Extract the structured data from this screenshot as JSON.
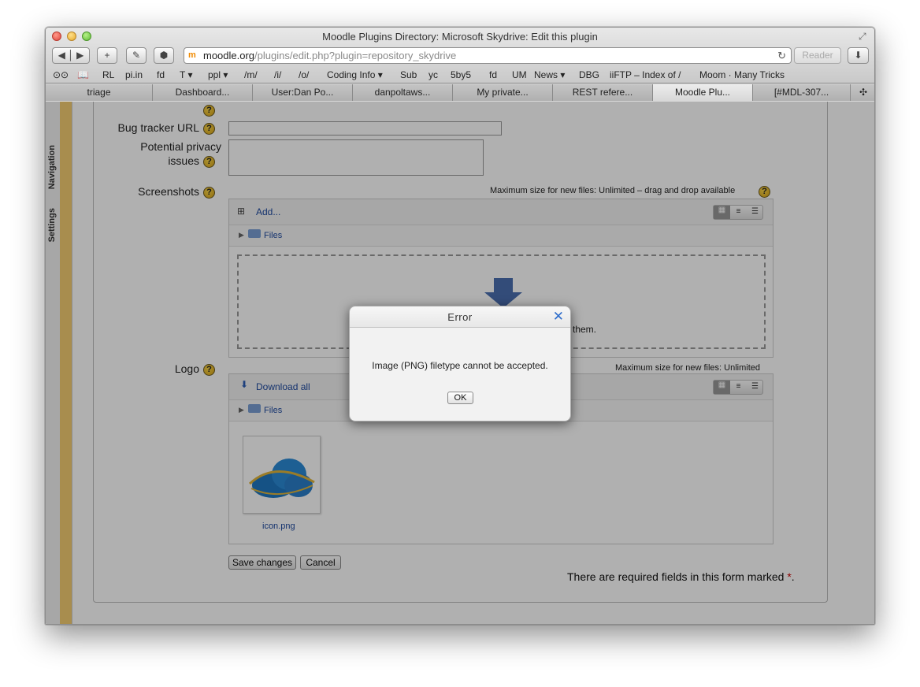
{
  "window": {
    "title": "Moodle Plugins Directory: Microsoft Skydrive: Edit this plugin"
  },
  "toolbar": {
    "url_host": "moodle.org",
    "url_path": "/plugins/edit.php?plugin=repository_skydrive",
    "reader_label": "Reader"
  },
  "bookmarks": [
    "RL",
    "pi.in",
    "fd",
    "T ▾",
    "ppl ▾",
    "/m/",
    "/i/",
    "/o/",
    "Coding Info ▾",
    "Sub",
    "yc",
    "5by5",
    "fd",
    "UM",
    "News ▾",
    "DBG",
    "iiFTP – Index of /",
    "Moom · Many Tricks"
  ],
  "tabs": [
    "triage",
    "Dashboard...",
    "User:Dan Po...",
    "danpoltaws...",
    "My private...",
    "REST refere...",
    "Moodle Plu...",
    "[#MDL-307..."
  ],
  "dock": {
    "navigation": "Navigation",
    "settings": "Settings"
  },
  "form": {
    "bug_tracker_label": "Bug tracker URL",
    "privacy_label_1": "Potential privacy",
    "privacy_label_2": "issues",
    "screenshots_label": "Screenshots",
    "screenshots_max_note": "Maximum size for new files: Unlimited – drag and drop available",
    "add_label": "Add...",
    "files_label": "Files",
    "drop_text_partial": "them.",
    "logo_label": "Logo",
    "logo_max_note": "Maximum size for new files: Unlimited",
    "download_all_label": "Download all",
    "logo_files_label": "Files",
    "logo_file_name": "icon.png",
    "save_label": "Save changes",
    "cancel_label": "Cancel",
    "required_note": "There are required fields in this form marked",
    "required_star": "*",
    "required_period": "."
  },
  "dialog": {
    "title": "Error",
    "message": "Image (PNG) filetype cannot be accepted.",
    "ok_label": "OK"
  }
}
